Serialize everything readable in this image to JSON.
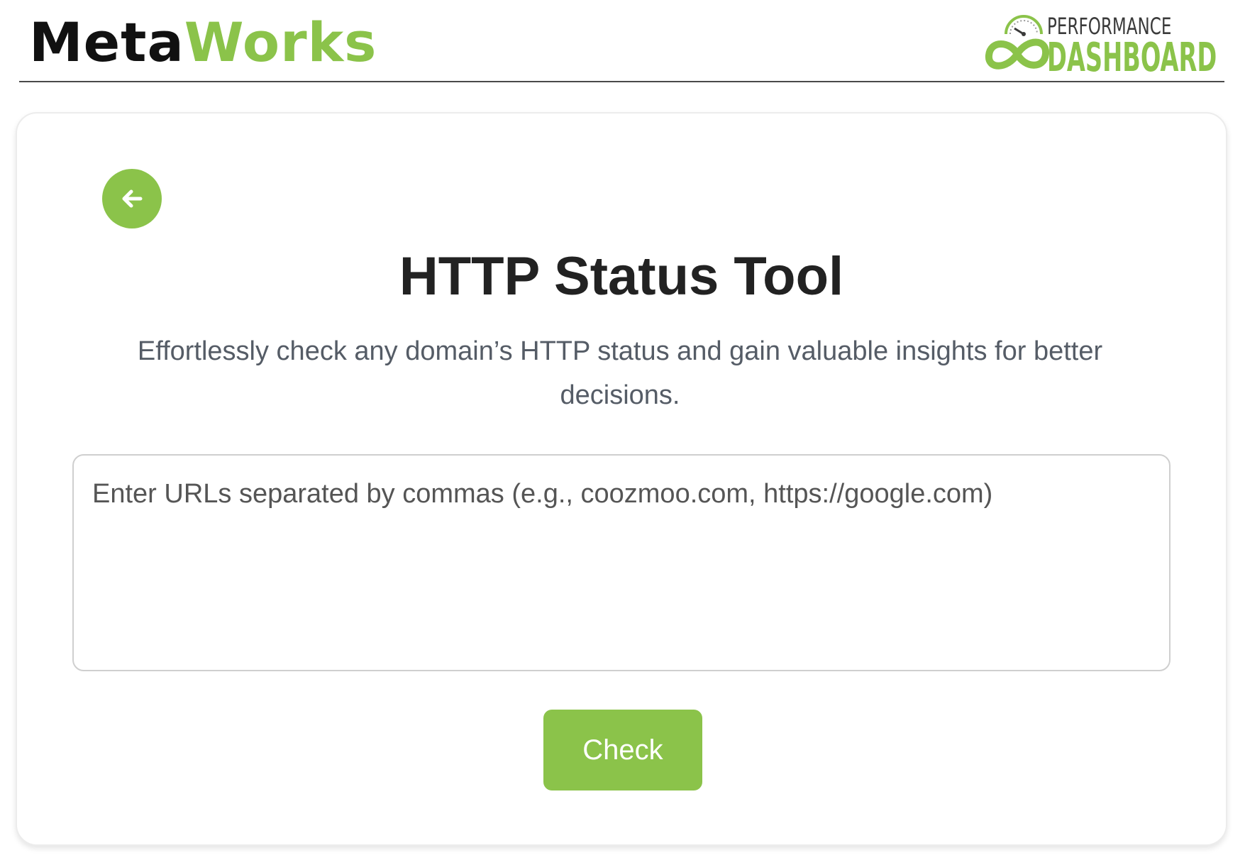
{
  "header": {
    "brand_part1": "Meta",
    "brand_part2": "Works",
    "dashboard_logo_top": "PERFORMANCE",
    "dashboard_logo_bottom": "DASHBOARD"
  },
  "main": {
    "title": "HTTP Status Tool",
    "subtitle": "Effortlessly check any domain’s HTTP status and gain valuable insights for better decisions.",
    "url_input": {
      "value": "",
      "placeholder": "Enter URLs separated by commas (e.g., coozmoo.com, https://google.com)"
    },
    "check_label": "Check"
  },
  "icons": {
    "back": "arrow-left-icon",
    "gauge": "speedometer-icon",
    "infinity": "infinity-icon"
  },
  "colors": {
    "accent": "#8bc34a",
    "title": "#222222",
    "subtitle": "#555c66",
    "header_rule": "#4a4a4a"
  }
}
